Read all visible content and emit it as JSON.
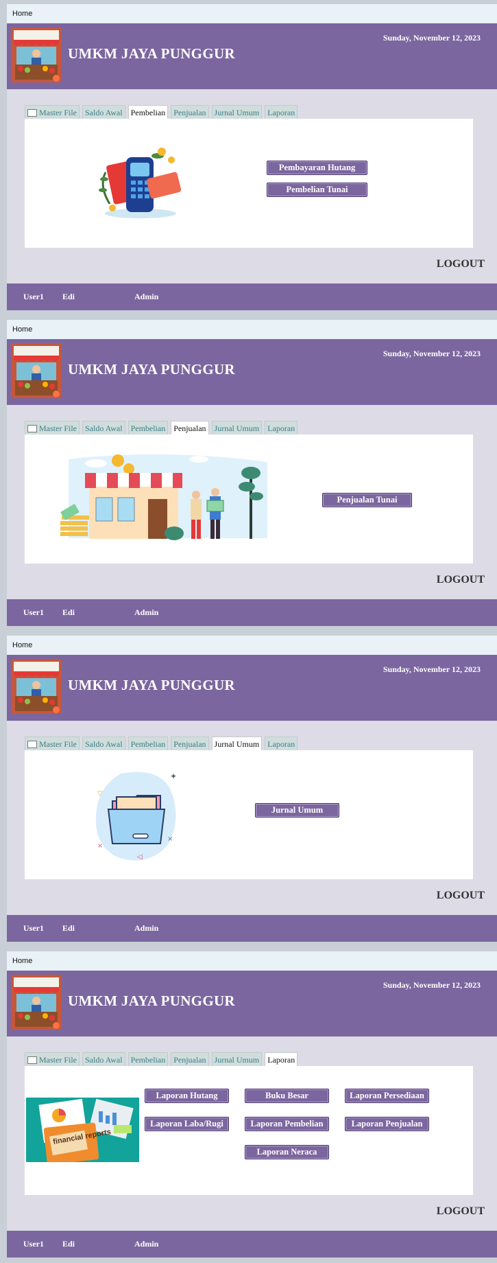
{
  "common": {
    "home": "Home",
    "app_title": "UMKM JAYA PUNGGUR",
    "date": "Sunday, November 12, 2023",
    "logout": "LOGOUT",
    "footer": {
      "user_label": "User1",
      "user_name": "Edi",
      "role": "Admin"
    },
    "tabs": [
      "Master File",
      "Saldo Awal",
      "Pembelian",
      "Penjualan",
      "Jurnal Umum",
      "Laporan"
    ]
  },
  "panels": [
    {
      "active_tab": "Pembelian",
      "buttons": [
        "Pembayaran Hutang",
        "Pembelian Tunai"
      ]
    },
    {
      "active_tab": "Penjualan",
      "buttons": [
        "Penjualan Tunai"
      ]
    },
    {
      "active_tab": "Jurnal Umum",
      "buttons": [
        "Jurnal Umum"
      ]
    },
    {
      "active_tab": "Laporan",
      "buttons": [
        "Laporan Hutang",
        "Buku Besar",
        "Laporan Persediaan",
        "Laporan Laba/Rugi",
        "Laporan Pembelian",
        "Laporan Penjualan",
        "Laporan Neraca"
      ],
      "illustration_text": "financial reports"
    }
  ],
  "colors": {
    "header": "#7c669f",
    "panel": "#dddbe6",
    "tab": "#cfdedc",
    "tab_text": "#3f7d86"
  },
  "icons": [
    "market-stall-logo-icon",
    "card-payment-illustration",
    "shop-illustration",
    "folder-illustration",
    "financial-reports-illustration",
    "document-icon"
  ]
}
